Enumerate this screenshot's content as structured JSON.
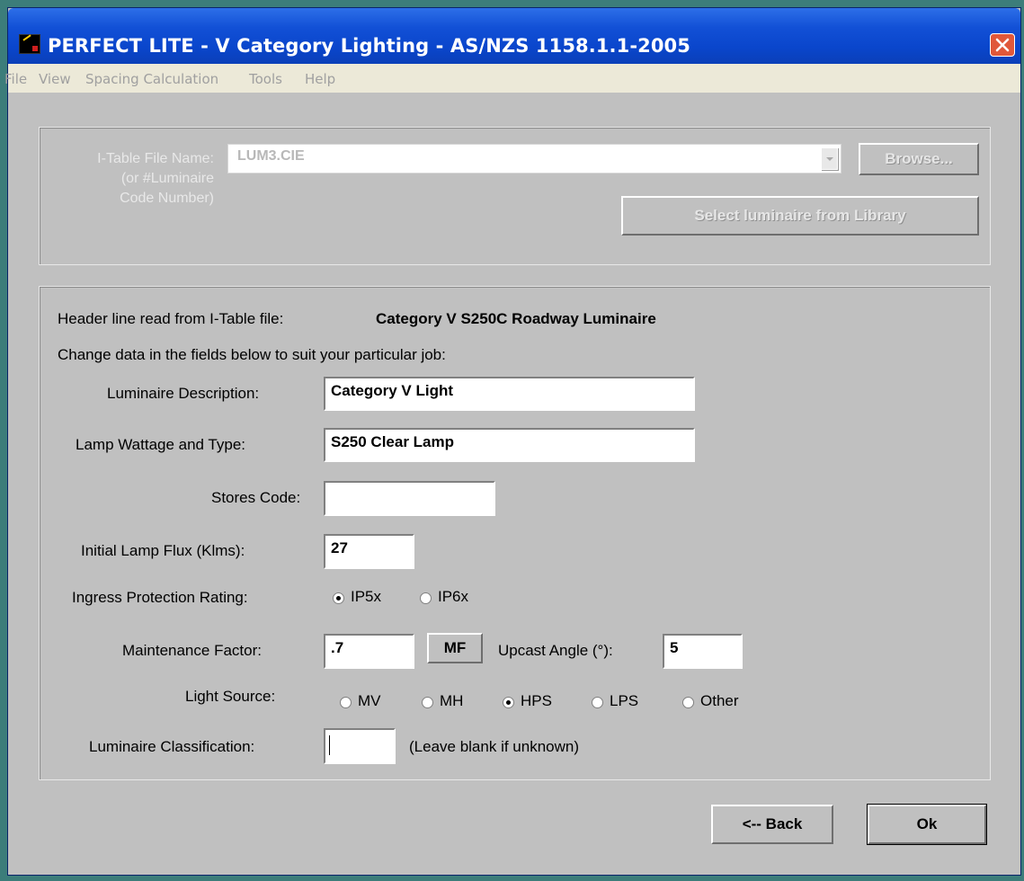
{
  "window": {
    "title": "PERFECT LITE - V Category Lighting - AS/NZS 1158.1.1-2005"
  },
  "menu": [
    "File",
    "View",
    "Spacing Calculation",
    "Tools",
    "Help"
  ],
  "itable": {
    "label_line1": "I-Table File Name:",
    "label_line2": "(or #Luminaire",
    "label_line3": "Code Number)",
    "file_value": "LUM3.CIE",
    "browse_label": "Browse...",
    "library_label": "Select luminaire from Library"
  },
  "details": {
    "header_label": "Header line read from I-Table file:",
    "header_value": "Category V S250C Roadway Luminaire",
    "instruction": "Change data in the fields below to suit your particular job:",
    "luminaire_description": {
      "label": "Luminaire Description:",
      "value": "Category V Light"
    },
    "lamp_wattage": {
      "label": "Lamp Wattage and Type:",
      "value": "S250 Clear Lamp"
    },
    "stores_code": {
      "label": "Stores Code:",
      "value": ""
    },
    "initial_flux": {
      "label": "Initial Lamp Flux (Klms):",
      "value": "27"
    },
    "ingress": {
      "label": "Ingress Protection Rating:",
      "options": [
        "IP5x",
        "IP6x"
      ],
      "selected": "IP5x"
    },
    "maintenance": {
      "label": "Maintenance Factor:",
      "value": ".7",
      "mf_button": "MF"
    },
    "upcast": {
      "label": "Upcast Angle (°):",
      "value": "5"
    },
    "light_source": {
      "label": "Light Source:",
      "options": [
        "MV",
        "MH",
        "HPS",
        "LPS",
        "Other"
      ],
      "selected": "HPS"
    },
    "classification": {
      "label": "Luminaire Classification:",
      "value": "",
      "hint": "(Leave blank if unknown)"
    }
  },
  "footer": {
    "back_label": "<-- Back",
    "ok_label": "Ok"
  }
}
